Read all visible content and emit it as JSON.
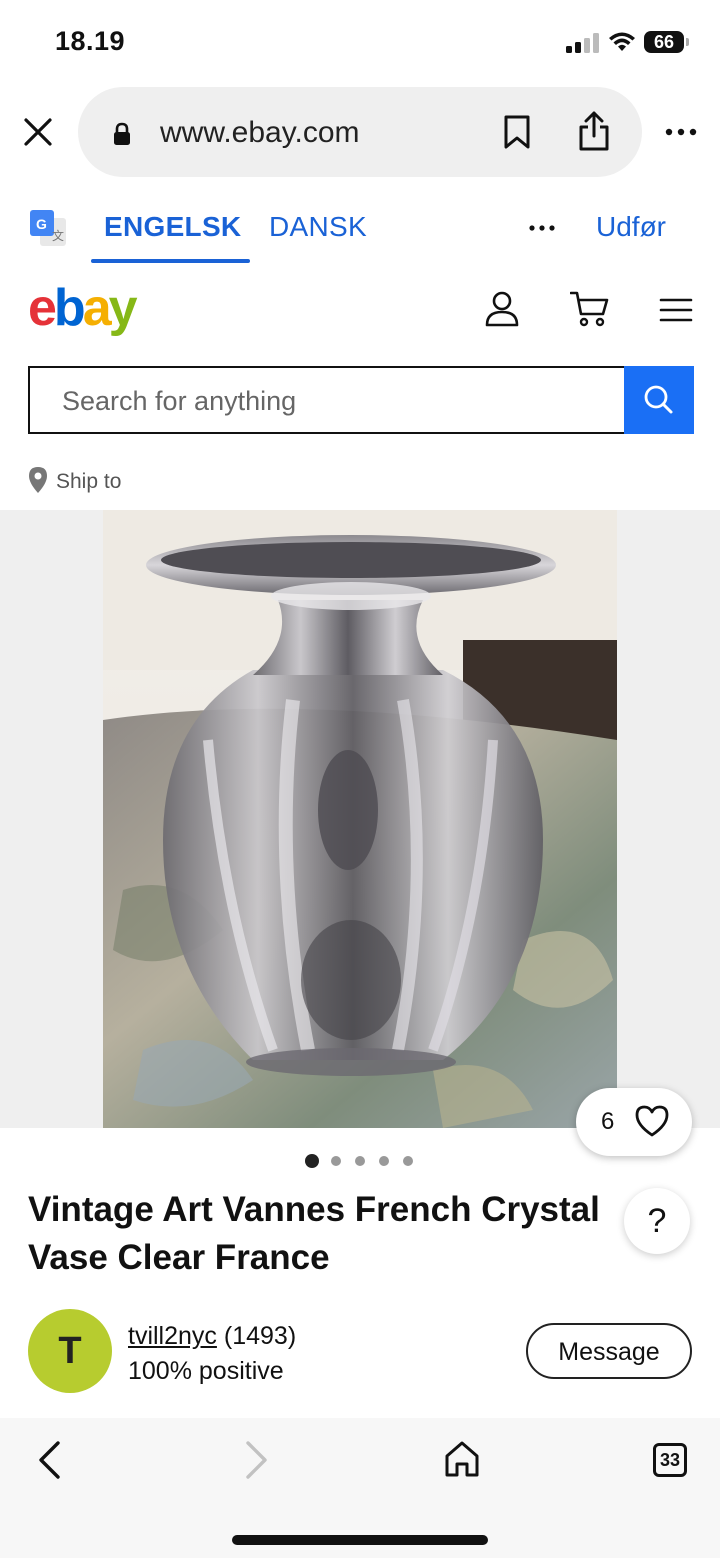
{
  "status": {
    "time": "18.19",
    "battery": "66"
  },
  "browser": {
    "url": "www.ebay.com",
    "close_icon": "close-icon",
    "lock_icon": "lock-icon"
  },
  "translate": {
    "tab_source": "ENGELSK",
    "tab_target": "DANSK",
    "done": "Udfør"
  },
  "header": {
    "logo_letters": [
      "e",
      "b",
      "a",
      "y"
    ],
    "logo_colors": [
      "#e53238",
      "#0064d2",
      "#f5af02",
      "#86b817"
    ]
  },
  "search": {
    "placeholder": "Search for anything"
  },
  "ship": {
    "label": "Ship to"
  },
  "listing": {
    "watchers": "6",
    "image_count": 5,
    "active_image": 1,
    "title": "Vintage Art Vannes French Crystal Vase Clear France",
    "help": "?"
  },
  "seller": {
    "initial": "T",
    "name": "tvill2nyc",
    "score": "(1493)",
    "feedback": "100% positive",
    "message_label": "Message"
  },
  "toolbar": {
    "tabs_count": "33"
  },
  "colors": {
    "accent": "#1a62d6",
    "search_button": "#1a6ff5",
    "avatar": "#b7cc2f"
  }
}
